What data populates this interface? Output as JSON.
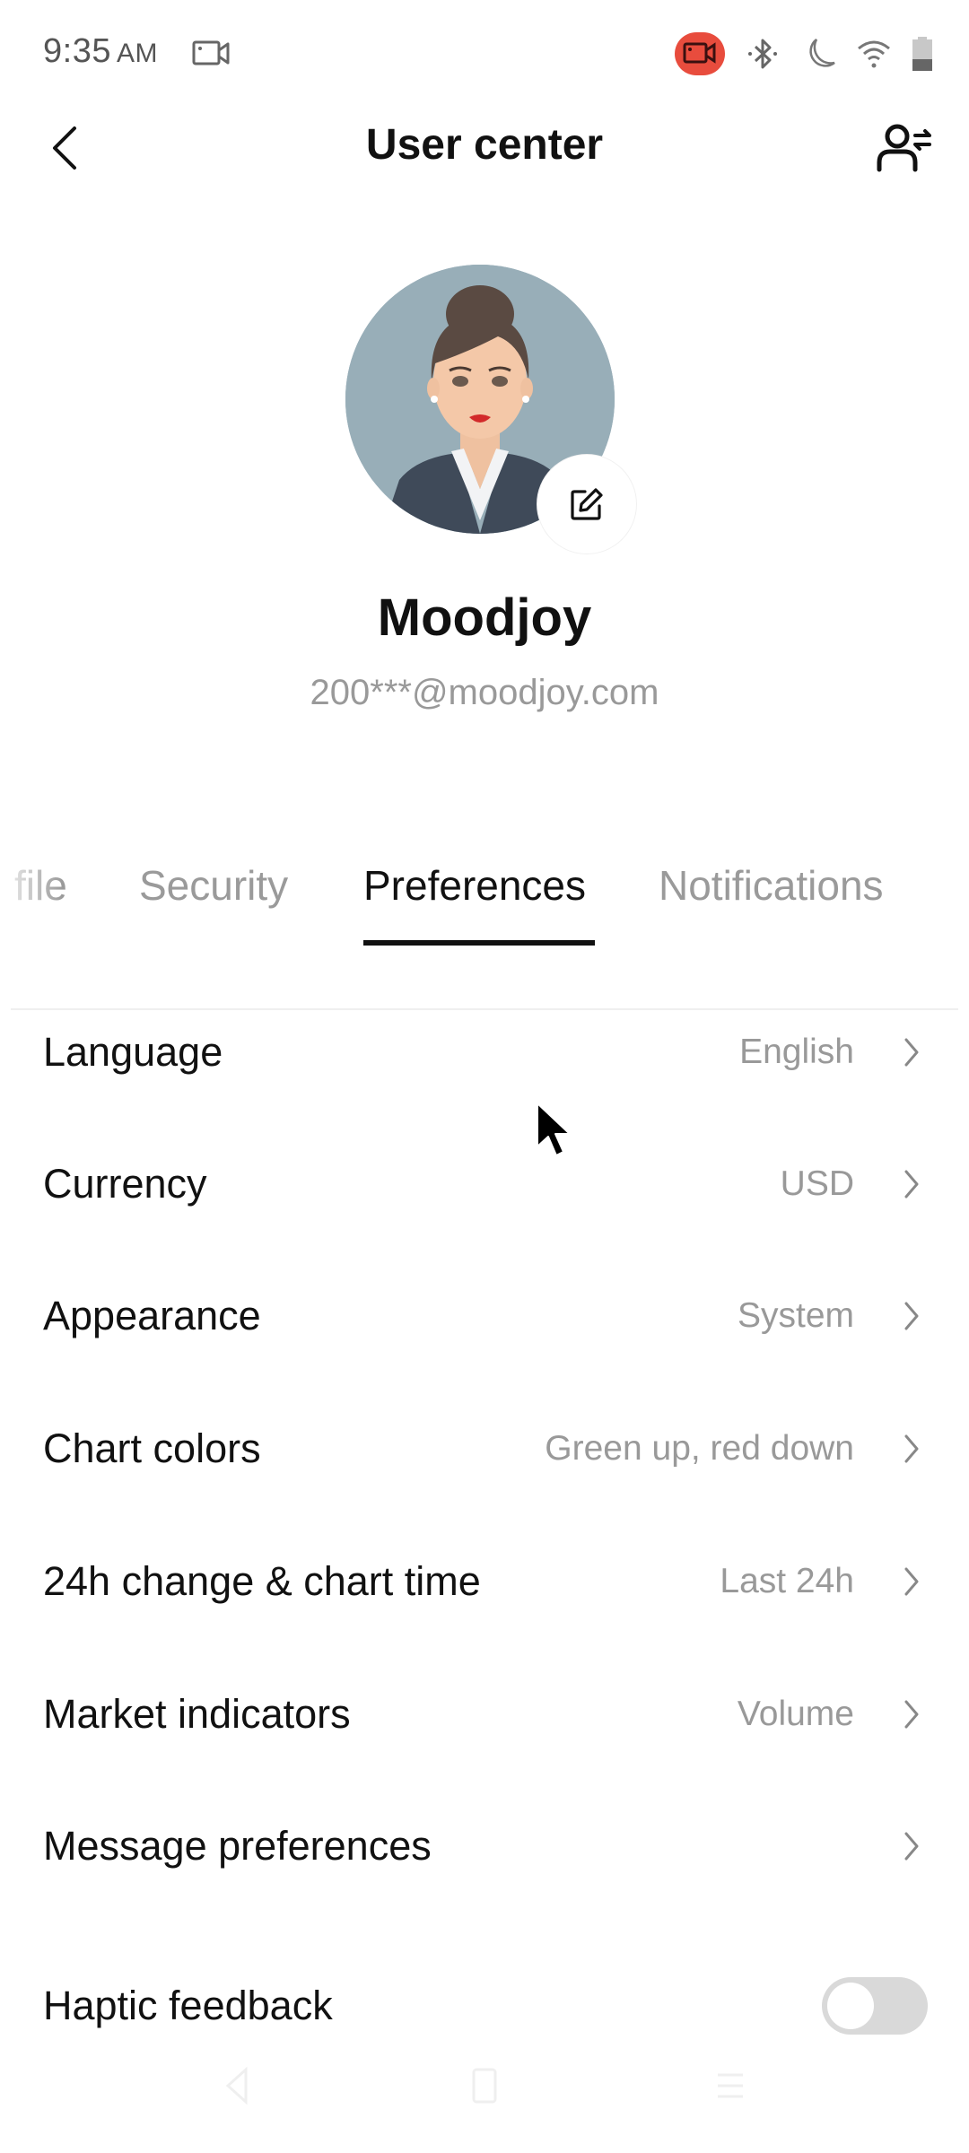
{
  "status_bar": {
    "time": "9:35",
    "ampm": "AM",
    "icons": [
      "screen-cast-icon",
      "screen-record-icon",
      "bluetooth-icon",
      "do-not-disturb-moon-icon",
      "wifi-icon",
      "battery-icon"
    ],
    "record_color": "#e84c3d"
  },
  "header": {
    "title": "User center",
    "back_icon": "chevron-left-icon",
    "switch_account_icon": "user-switch-icon"
  },
  "profile": {
    "name": "Moodjoy",
    "email": "200***@moodjoy.com",
    "edit_icon": "edit-pencil-icon"
  },
  "tabs": [
    {
      "label": "file",
      "full_label": "Profile",
      "active": false
    },
    {
      "label": "Security",
      "active": false
    },
    {
      "label": "Preferences",
      "active": true
    },
    {
      "label": "Notifications",
      "active": false
    }
  ],
  "preferences": [
    {
      "label": "Language",
      "value": "English"
    },
    {
      "label": "Currency",
      "value": "USD"
    },
    {
      "label": "Appearance",
      "value": "System"
    },
    {
      "label": "Chart colors",
      "value": "Green up, red down"
    },
    {
      "label": "24h change & chart time",
      "value": "Last 24h"
    },
    {
      "label": "Market indicators",
      "value": "Volume"
    },
    {
      "label": "Message preferences",
      "value": ""
    },
    {
      "label": "Haptic feedback",
      "toggle": false
    }
  ],
  "nav_bar": {
    "icons": [
      "nav-back-icon",
      "nav-home-icon",
      "nav-recents-icon"
    ]
  },
  "colors": {
    "text_primary": "#111111",
    "text_secondary": "#999999",
    "toggle_off": "#d9d9d9",
    "avatar_bg": "#98aeb8"
  }
}
